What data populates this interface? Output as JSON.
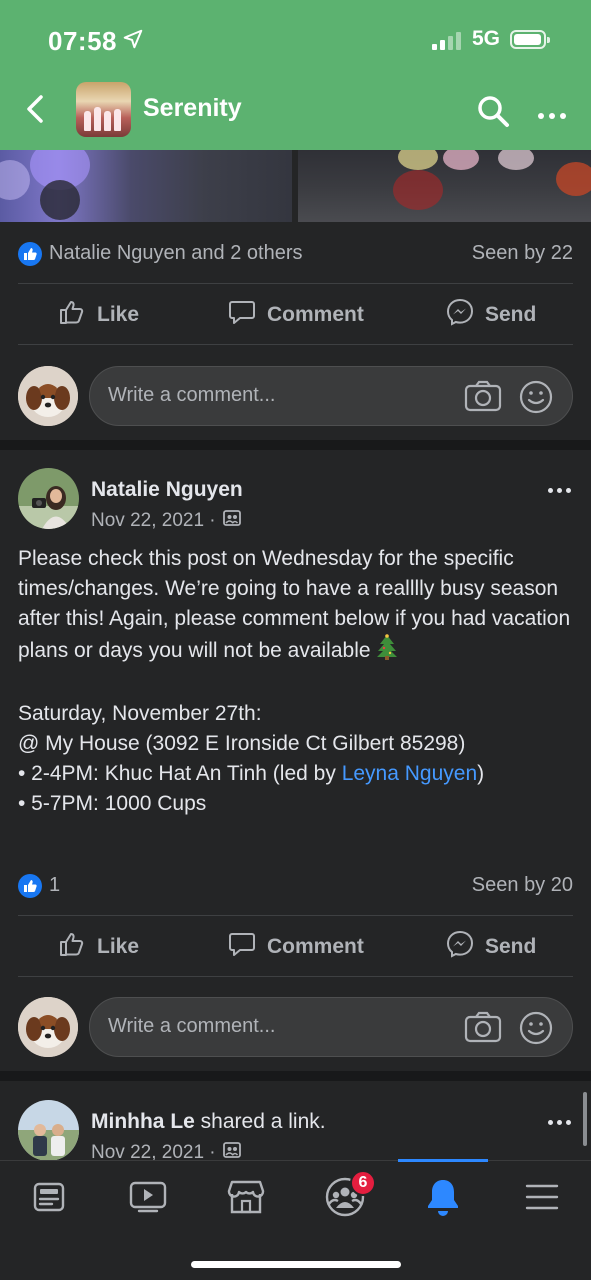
{
  "status_bar": {
    "time": "07:58",
    "network": "5G"
  },
  "header": {
    "group_name": "Serenity",
    "back_icon": "chevron-left-icon",
    "search_icon": "search-icon",
    "more_icon": "more-icon"
  },
  "post1": {
    "reactions_text": "Natalie Nguyen and 2 others",
    "seen": "Seen by 22",
    "actions": {
      "like": "Like",
      "comment": "Comment",
      "send": "Send"
    },
    "comment_placeholder": "Write a comment..."
  },
  "post2": {
    "author": "Natalie Nguyen",
    "date": "Nov 22, 2021 ·",
    "body": {
      "line1": "Please check this post on Wednesday for the specific times/changes. We’re going to have a realllly busy season after this! Again, please comment below if you had vacation plans or days you will not be available",
      "emoji": "christmas-tree-icon",
      "line2": "Saturday, November 27th:",
      "line3": "@ My House (3092 E Ironside Ct Gilbert 85298)",
      "line4_pre": "• 2-4PM: Khuc Hat An Tinh (led by ",
      "line4_link": "Leyna Nguyen",
      "line4_post": ")",
      "line5": "• 5-7PM: 1000 Cups"
    },
    "reaction_count": "1",
    "seen": "Seen by 20",
    "actions": {
      "like": "Like",
      "comment": "Comment",
      "send": "Send"
    },
    "comment_placeholder": "Write a comment..."
  },
  "post3": {
    "author": "Minhha Le",
    "action_text": " shared a link.",
    "date": "Nov 22, 2021 ·"
  },
  "tabbar": {
    "tabs": [
      "news-feed-icon",
      "watch-icon",
      "marketplace-icon",
      "groups-icon",
      "notifications-icon",
      "menu-icon"
    ],
    "groups_badge": "6",
    "active_tab": "notifications-icon"
  },
  "colors": {
    "header": "#5cb270",
    "background": "#242526",
    "accent": "#2d88ff",
    "link": "#4599ff",
    "badge": "#e41e3f"
  }
}
